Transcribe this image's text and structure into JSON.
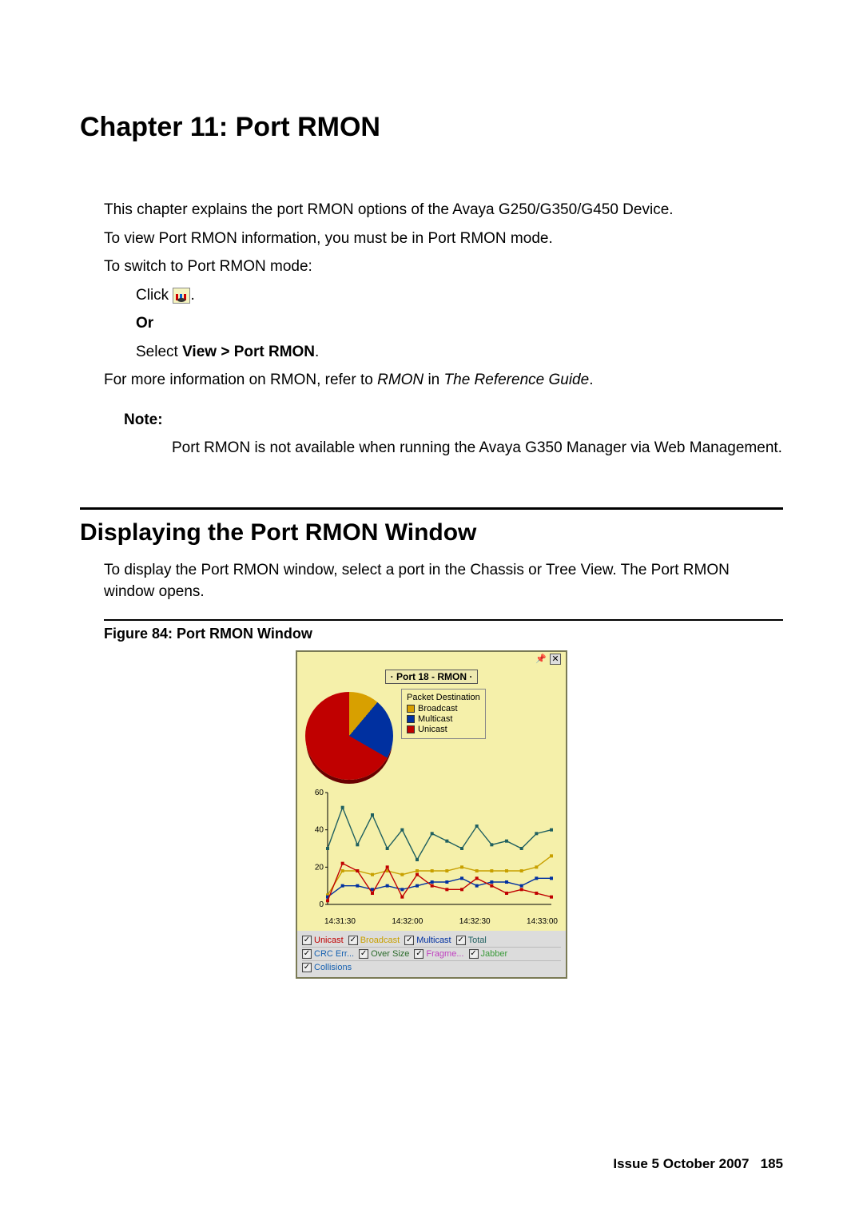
{
  "chapter_title": "Chapter 11: Port RMON",
  "intro": {
    "p1": "This chapter explains the port RMON options of the Avaya G250/G350/G450 Device.",
    "p2": "To view Port RMON information, you must be in Port RMON mode.",
    "p3": "To switch to Port RMON mode:",
    "click_prefix": "Click ",
    "click_suffix": ".",
    "or": "Or",
    "select_prefix": "Select ",
    "select_bold": "View > Port RMON",
    "select_suffix": ".",
    "moreinfo_prefix": "For more information on RMON, refer to ",
    "moreinfo_i1": "RMON",
    "moreinfo_mid": " in ",
    "moreinfo_i2": "The Reference Guide",
    "moreinfo_suffix": ".",
    "note_label": "Note:",
    "note_body": "Port RMON is not available when running the Avaya G350 Manager via Web Management."
  },
  "section2": {
    "heading": "Displaying the Port RMON Window",
    "p1": "To display the Port RMON window, select a port in the Chassis or Tree View. The Port RMON window opens.",
    "figure_caption": "Figure 84: Port RMON Window"
  },
  "rmon_window": {
    "port_label": "· Port 18 - RMON ·",
    "legend_title": "Packet Destination",
    "legend_items": [
      "Broadcast",
      "Multicast",
      "Unicast"
    ],
    "toggles": {
      "row1": [
        "Unicast",
        "Broadcast",
        "Multicast",
        "Total"
      ],
      "row2": [
        "CRC Err...",
        "Over Size",
        "Fragme...",
        "Jabber"
      ],
      "row3": [
        "Collisions"
      ]
    }
  },
  "chart_data": [
    {
      "type": "pie",
      "title": "Packet Destination",
      "series": [
        {
          "name": "Broadcast",
          "value": 12,
          "color": "#d8a000"
        },
        {
          "name": "Multicast",
          "value": 22,
          "color": "#0030a0"
        },
        {
          "name": "Unicast",
          "value": 66,
          "color": "#c00000"
        }
      ]
    },
    {
      "type": "line",
      "title": "",
      "xlabel": "",
      "ylabel": "",
      "ylim": [
        0,
        60
      ],
      "x_ticks": [
        "14:31:30",
        "14:32:00",
        "14:32:30",
        "14:33:00"
      ],
      "x": [
        0,
        1,
        2,
        3,
        4,
        5,
        6,
        7,
        8,
        9,
        10,
        11,
        12,
        13,
        14,
        15
      ],
      "series": [
        {
          "name": "Total",
          "color": "#206060",
          "values": [
            30,
            52,
            32,
            48,
            30,
            40,
            24,
            38,
            34,
            30,
            42,
            32,
            34,
            30,
            38,
            40
          ]
        },
        {
          "name": "Broadcast",
          "color": "#c8a000",
          "values": [
            5,
            18,
            18,
            16,
            18,
            16,
            18,
            18,
            18,
            20,
            18,
            18,
            18,
            18,
            20,
            26
          ]
        },
        {
          "name": "Multicast",
          "color": "#0030a0",
          "values": [
            4,
            10,
            10,
            8,
            10,
            8,
            10,
            12,
            12,
            14,
            10,
            12,
            12,
            10,
            14,
            14
          ]
        },
        {
          "name": "Unicast",
          "color": "#c00000",
          "values": [
            2,
            22,
            18,
            6,
            20,
            4,
            16,
            10,
            8,
            8,
            14,
            10,
            6,
            8,
            6,
            4
          ]
        }
      ]
    }
  ],
  "footer": {
    "issue": "Issue 5   October 2007",
    "page": "185"
  }
}
